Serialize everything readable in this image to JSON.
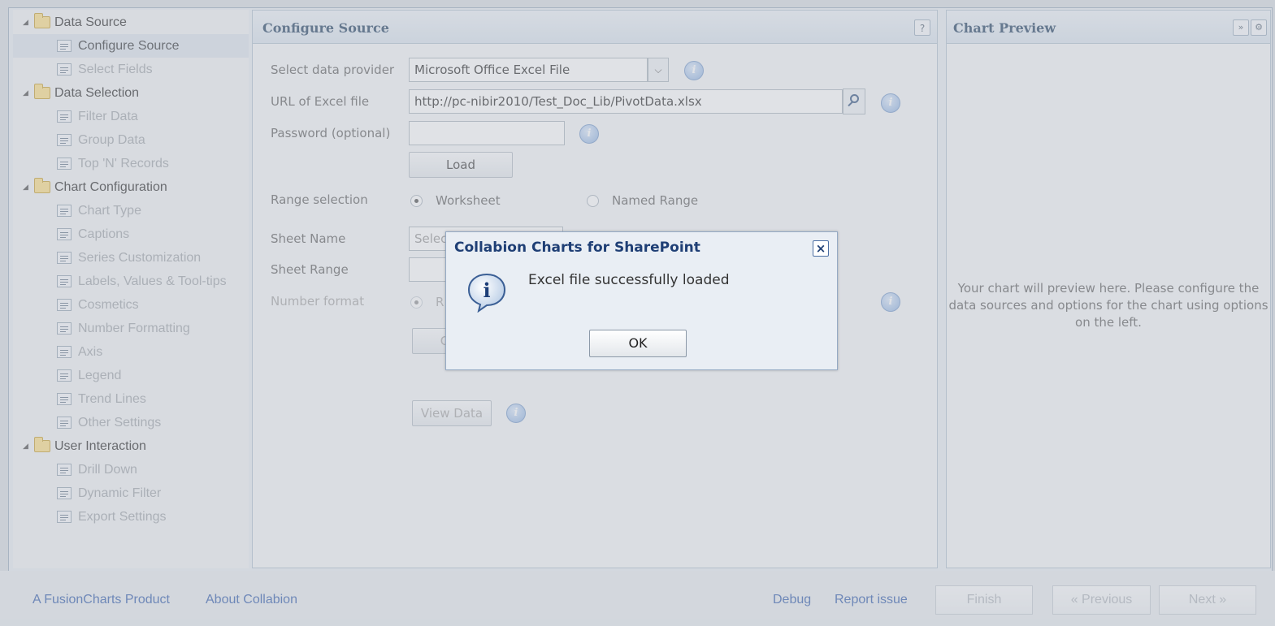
{
  "sidebar": {
    "items": [
      {
        "type": "group",
        "label": "Data Source"
      },
      {
        "type": "item",
        "label": "Configure Source",
        "selected": true
      },
      {
        "type": "item",
        "label": "Select Fields"
      },
      {
        "type": "group",
        "label": "Data Selection"
      },
      {
        "type": "item",
        "label": "Filter Data"
      },
      {
        "type": "item",
        "label": "Group Data"
      },
      {
        "type": "item",
        "label": "Top 'N' Records"
      },
      {
        "type": "group",
        "label": "Chart Configuration"
      },
      {
        "type": "item",
        "label": "Chart Type"
      },
      {
        "type": "item",
        "label": "Captions"
      },
      {
        "type": "item",
        "label": "Series Customization"
      },
      {
        "type": "item",
        "label": "Labels, Values & Tool-tips"
      },
      {
        "type": "item",
        "label": "Cosmetics"
      },
      {
        "type": "item",
        "label": "Number Formatting"
      },
      {
        "type": "item",
        "label": "Axis"
      },
      {
        "type": "item",
        "label": "Legend"
      },
      {
        "type": "item",
        "label": "Trend Lines"
      },
      {
        "type": "item",
        "label": "Other Settings"
      },
      {
        "type": "group",
        "label": "User Interaction"
      },
      {
        "type": "item",
        "label": "Drill Down"
      },
      {
        "type": "item",
        "label": "Dynamic Filter"
      },
      {
        "type": "item",
        "label": "Export Settings"
      }
    ]
  },
  "config": {
    "title": "Configure Source",
    "help": "?",
    "provider_label": "Select data provider",
    "provider_value": "Microsoft Office Excel File",
    "url_label": "URL of Excel file",
    "url_value": "http://pc-nibir2010/Test_Doc_Lib/PivotData.xlsx",
    "password_label": "Password (optional)",
    "password_value": "",
    "load_label": "Load",
    "range_label": "Range selection",
    "range_worksheet": "Worksheet",
    "range_named": "Named Range",
    "sheet_name_label": "Sheet Name",
    "sheet_name_value": "Selec",
    "sheet_range_label": "Sheet Range",
    "number_format_label": "Number format",
    "number_format_partial": "R",
    "hidden_button_partial": "C",
    "view_data_label": "View Data"
  },
  "preview": {
    "title": "Chart Preview",
    "expand": "»",
    "settings": "⚙",
    "message": "Your chart will preview here. Please configure the data sources and options for the chart using options on the left."
  },
  "footer": {
    "product_link": "A FusionCharts Product",
    "about_link": "About Collabion",
    "debug_link": "Debug",
    "report_link": "Report issue",
    "finish": "Finish",
    "previous": "« Previous",
    "next": "Next »"
  },
  "dialog": {
    "title": "Collabion Charts for SharePoint",
    "message": "Excel file successfully loaded",
    "ok": "OK",
    "close": "×",
    "icon_glyph": "i"
  },
  "info_glyph": "i"
}
